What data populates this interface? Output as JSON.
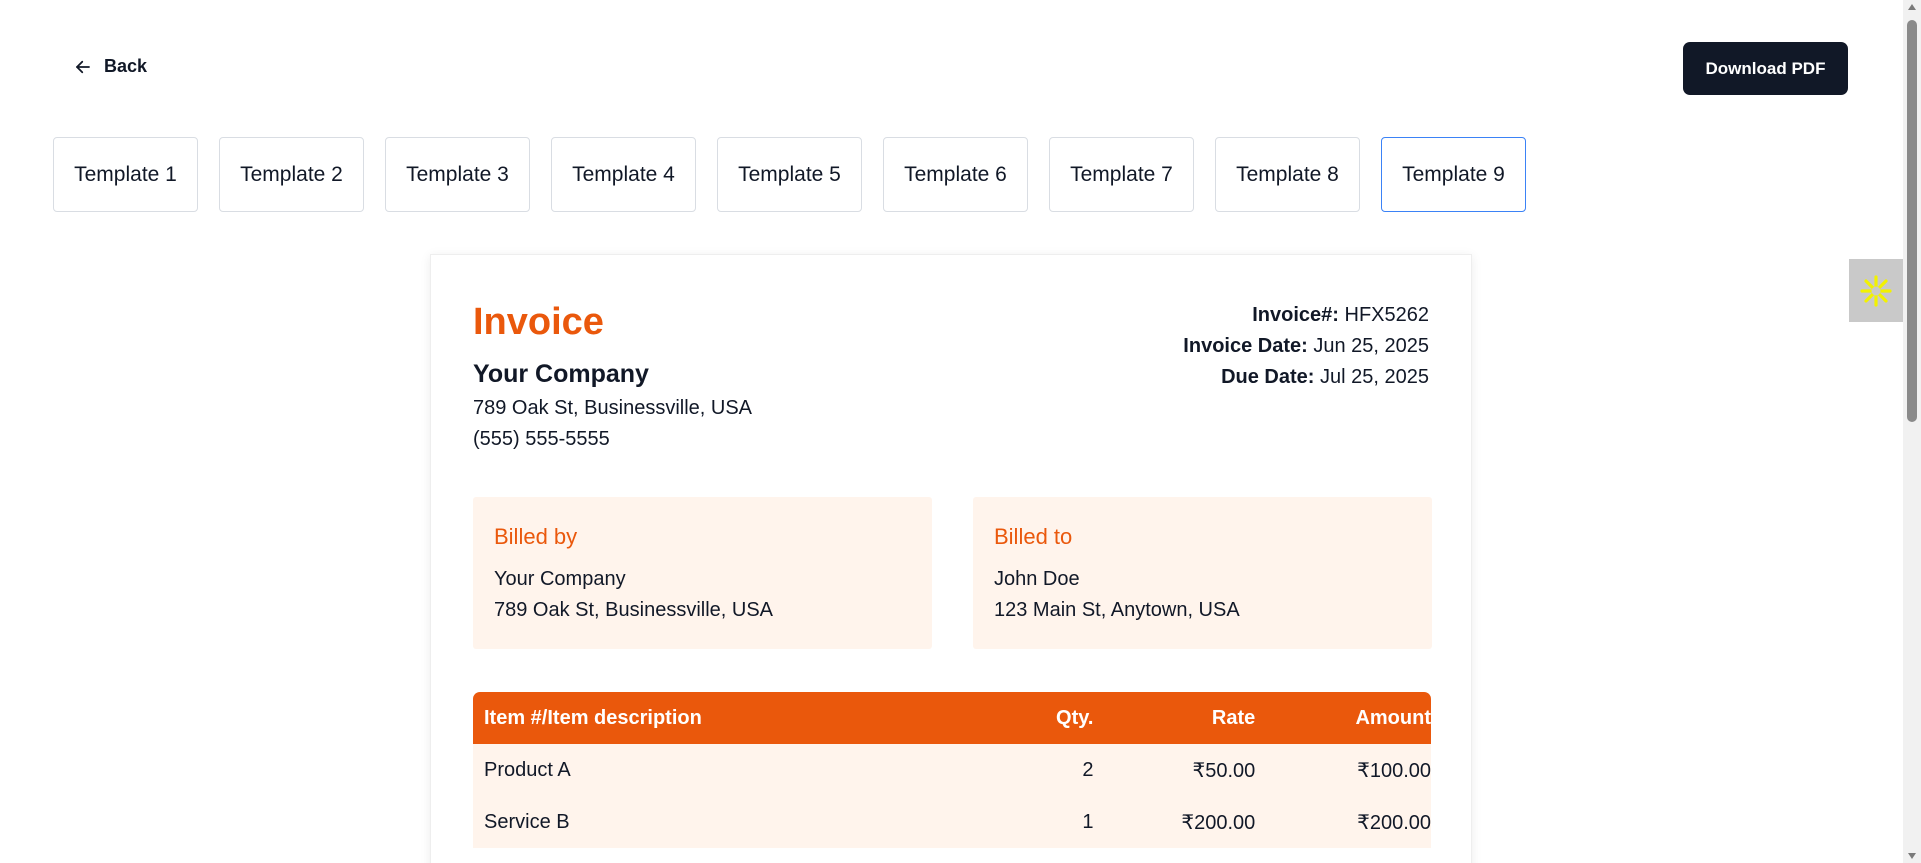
{
  "header": {
    "back_label": "Back",
    "download_label": "Download PDF"
  },
  "templates": [
    {
      "label": "Template 1",
      "active": false
    },
    {
      "label": "Template 2",
      "active": false
    },
    {
      "label": "Template 3",
      "active": false
    },
    {
      "label": "Template 4",
      "active": false
    },
    {
      "label": "Template 5",
      "active": false
    },
    {
      "label": "Template 6",
      "active": false
    },
    {
      "label": "Template 7",
      "active": false
    },
    {
      "label": "Template 8",
      "active": false
    },
    {
      "label": "Template 9",
      "active": true
    }
  ],
  "invoice": {
    "title": "Invoice",
    "company_name": "Your Company",
    "company_address": "789 Oak St, Businessville, USA",
    "company_phone": "(555) 555-5555",
    "number_label": "Invoice#:",
    "number": "HFX5262",
    "date_label": "Invoice Date:",
    "date": "Jun 25, 2025",
    "due_label": "Due Date:",
    "due": "Jul 25, 2025",
    "billed_by": {
      "heading": "Billed by",
      "name": "Your Company",
      "address": "789 Oak St, Businessville, USA"
    },
    "billed_to": {
      "heading": "Billed to",
      "name": "John Doe",
      "address": "123 Main St, Anytown, USA"
    },
    "table": {
      "columns": [
        "Item #/Item description",
        "Qty.",
        "Rate",
        "Amount"
      ],
      "rows": [
        [
          "Product A",
          "2",
          "₹50.00",
          "₹100.00"
        ],
        [
          "Service B",
          "1",
          "₹200.00",
          "₹200.00"
        ]
      ]
    }
  },
  "colors": {
    "accent": "#ea580c",
    "accent_bg": "#fff4ec",
    "primary_button": "#111827",
    "active_tab_border": "#3b82f6"
  },
  "icons": {
    "back": "arrow-left-icon",
    "widget": "asterisk-icon"
  }
}
